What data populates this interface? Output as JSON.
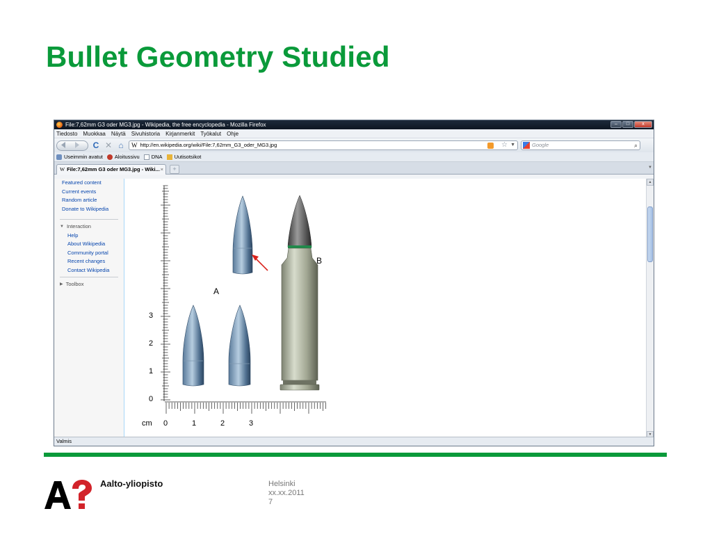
{
  "slide": {
    "title": "Bullet Geometry Studied",
    "accent_color": "#0a9a3a"
  },
  "browser": {
    "window_title": "File:7,62mm G3 oder MG3.jpg - Wikipedia, the free encyclopedia - Mozilla Firefox",
    "window_buttons": [
      "–",
      "□",
      "x"
    ],
    "menu": [
      "Tiedosto",
      "Muokkaa",
      "Näytä",
      "Sivuhistoria",
      "Kirjanmerkit",
      "Työkalut",
      "Ohje"
    ],
    "nav": {
      "back_forward_icon": "back-forward-icon",
      "reload_glyph": "C",
      "stop_glyph": "✕",
      "home_glyph": "⌂",
      "url": "http://en.wikipedia.org/wiki/File:7,62mm_G3_oder_MG3.jpg",
      "url_site_glyph": "W",
      "search_placeholder": "Google",
      "search_glyph": "⌕"
    },
    "bookmarks": [
      "Useimmin avatut",
      "Aloitussivu",
      "DNA",
      "Uutisotsikot"
    ],
    "tab": {
      "label": "File:7,62mm G3 oder MG3.jpg - Wiki...",
      "site_glyph": "W",
      "close_glyph": "×",
      "new_tab_glyph": "+"
    },
    "status": "Valmis"
  },
  "sidebar": {
    "top_links": [
      "Featured content",
      "Current events",
      "Random article",
      "Donate to Wikipedia"
    ],
    "interaction_heading": "Interaction",
    "interaction_links": [
      "Help",
      "About Wikipedia",
      "Community portal",
      "Recent changes",
      "Contact Wikipedia"
    ],
    "toolbox_heading": "Toolbox"
  },
  "figure": {
    "label_a": "A",
    "label_b": "B",
    "unit": "cm",
    "vertical_ticks": [
      "0",
      "1",
      "2",
      "3"
    ],
    "horizontal_ticks": [
      "0",
      "1",
      "2",
      "3"
    ]
  },
  "footer": {
    "org_name": "Aalto-yliopisto",
    "city": "Helsinki",
    "date": "xx.xx.2011",
    "page_number": "7"
  }
}
